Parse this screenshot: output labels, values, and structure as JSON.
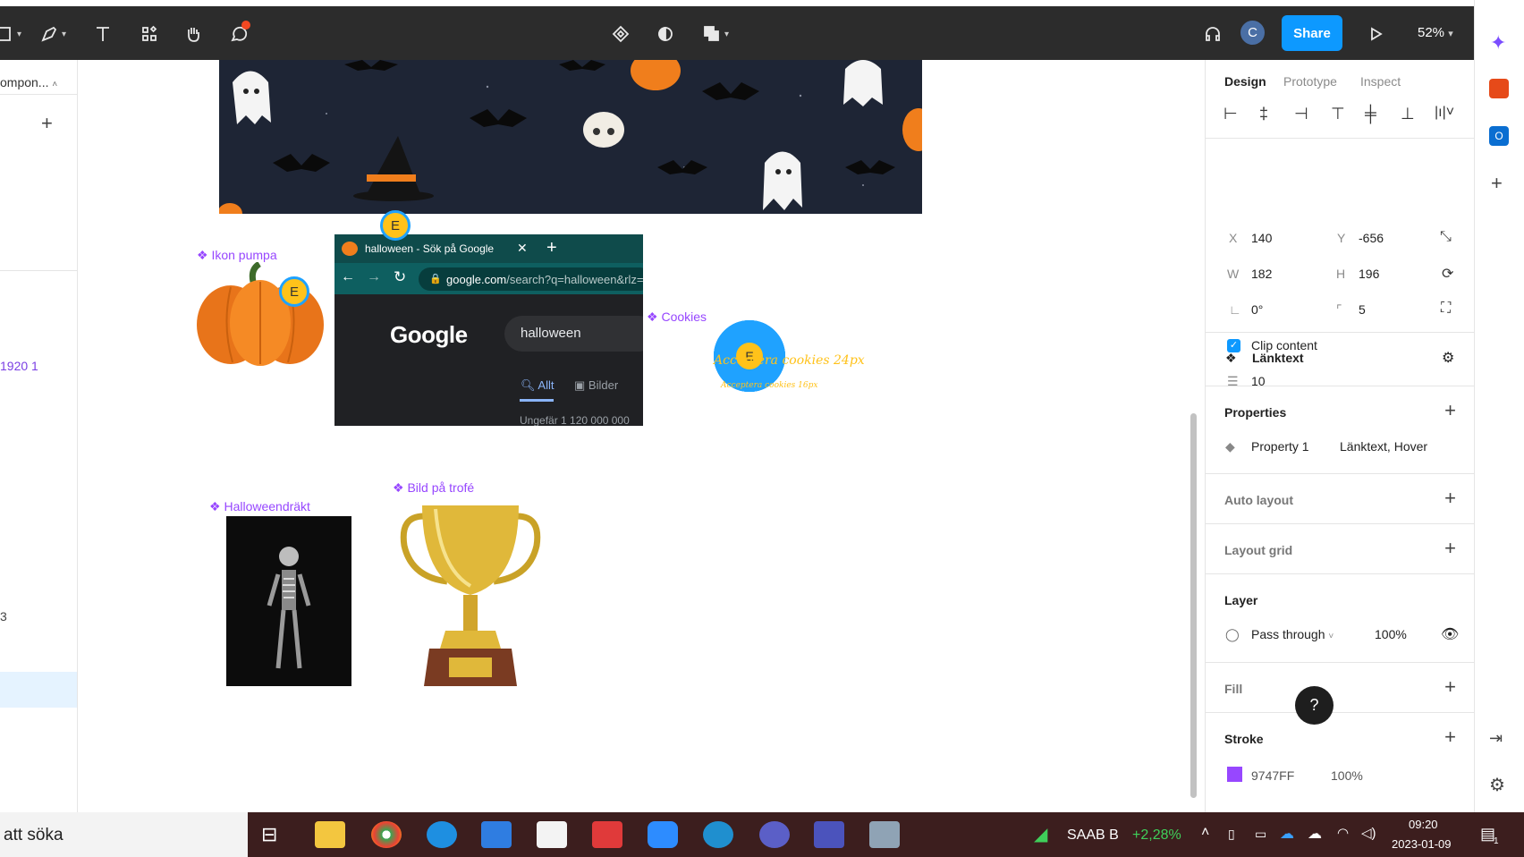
{
  "toolbar": {
    "share_label": "Share",
    "zoom": "52%",
    "avatar_initial": "C"
  },
  "left_panel": {
    "top_label": "ompon...",
    "item_1920": "1920 1",
    "item_3": "3"
  },
  "canvas": {
    "label_pumpa": "Ikon pumpa",
    "label_cookies": "Cookies",
    "cookies_text_large": "Acceptera cookies 24px",
    "cookies_text_small": "Acceptera cookies 16px",
    "label_costume": "Halloweendräkt",
    "label_trophy": "Bild på trofé",
    "browser_tab_title": "halloween - Sök på Google",
    "browser_url_domain": "google.com",
    "browser_url_path": "/search?q=halloween&rlz=",
    "google_logo": "Google",
    "google_query": "halloween",
    "tab_all": "Allt",
    "tab_images": "Bilder",
    "result_count": "Ungefär 1 120 000 000",
    "cursor_initial": "E"
  },
  "right_panel": {
    "tabs": [
      "Design",
      "Prototype",
      "Inspect"
    ],
    "x_label": "X",
    "x_value": "140",
    "y_label": "Y",
    "y_value": "-656",
    "w_label": "W",
    "w_value": "182",
    "h_label": "H",
    "h_value": "196",
    "rotation_value": "0°",
    "radius_value": "5",
    "clip_content_label": "Clip content",
    "spacing_value": "10",
    "component_name": "Länktext",
    "properties_title": "Properties",
    "property_name": "Property 1",
    "property_value": "Länktext, Hover",
    "auto_layout_title": "Auto layout",
    "layout_grid_title": "Layout grid",
    "layer_title": "Layer",
    "blend_mode": "Pass through",
    "layer_opacity": "100%",
    "fill_title": "Fill",
    "stroke_title": "Stroke",
    "stroke_color_hex": "9747FF",
    "stroke_opacity": "100%",
    "help_label": "?"
  },
  "taskbar": {
    "search_text": "att söka",
    "stock_name": "SAAB B",
    "stock_change": "+2,28%",
    "time": "09:20",
    "date": "2023-01-09",
    "notification_count": "1"
  },
  "colors": {
    "accent": "#0d99ff",
    "component_purple": "#9747ff",
    "toolbar_bg": "#2c2c2c",
    "stock_green": "#3fcf5a"
  }
}
